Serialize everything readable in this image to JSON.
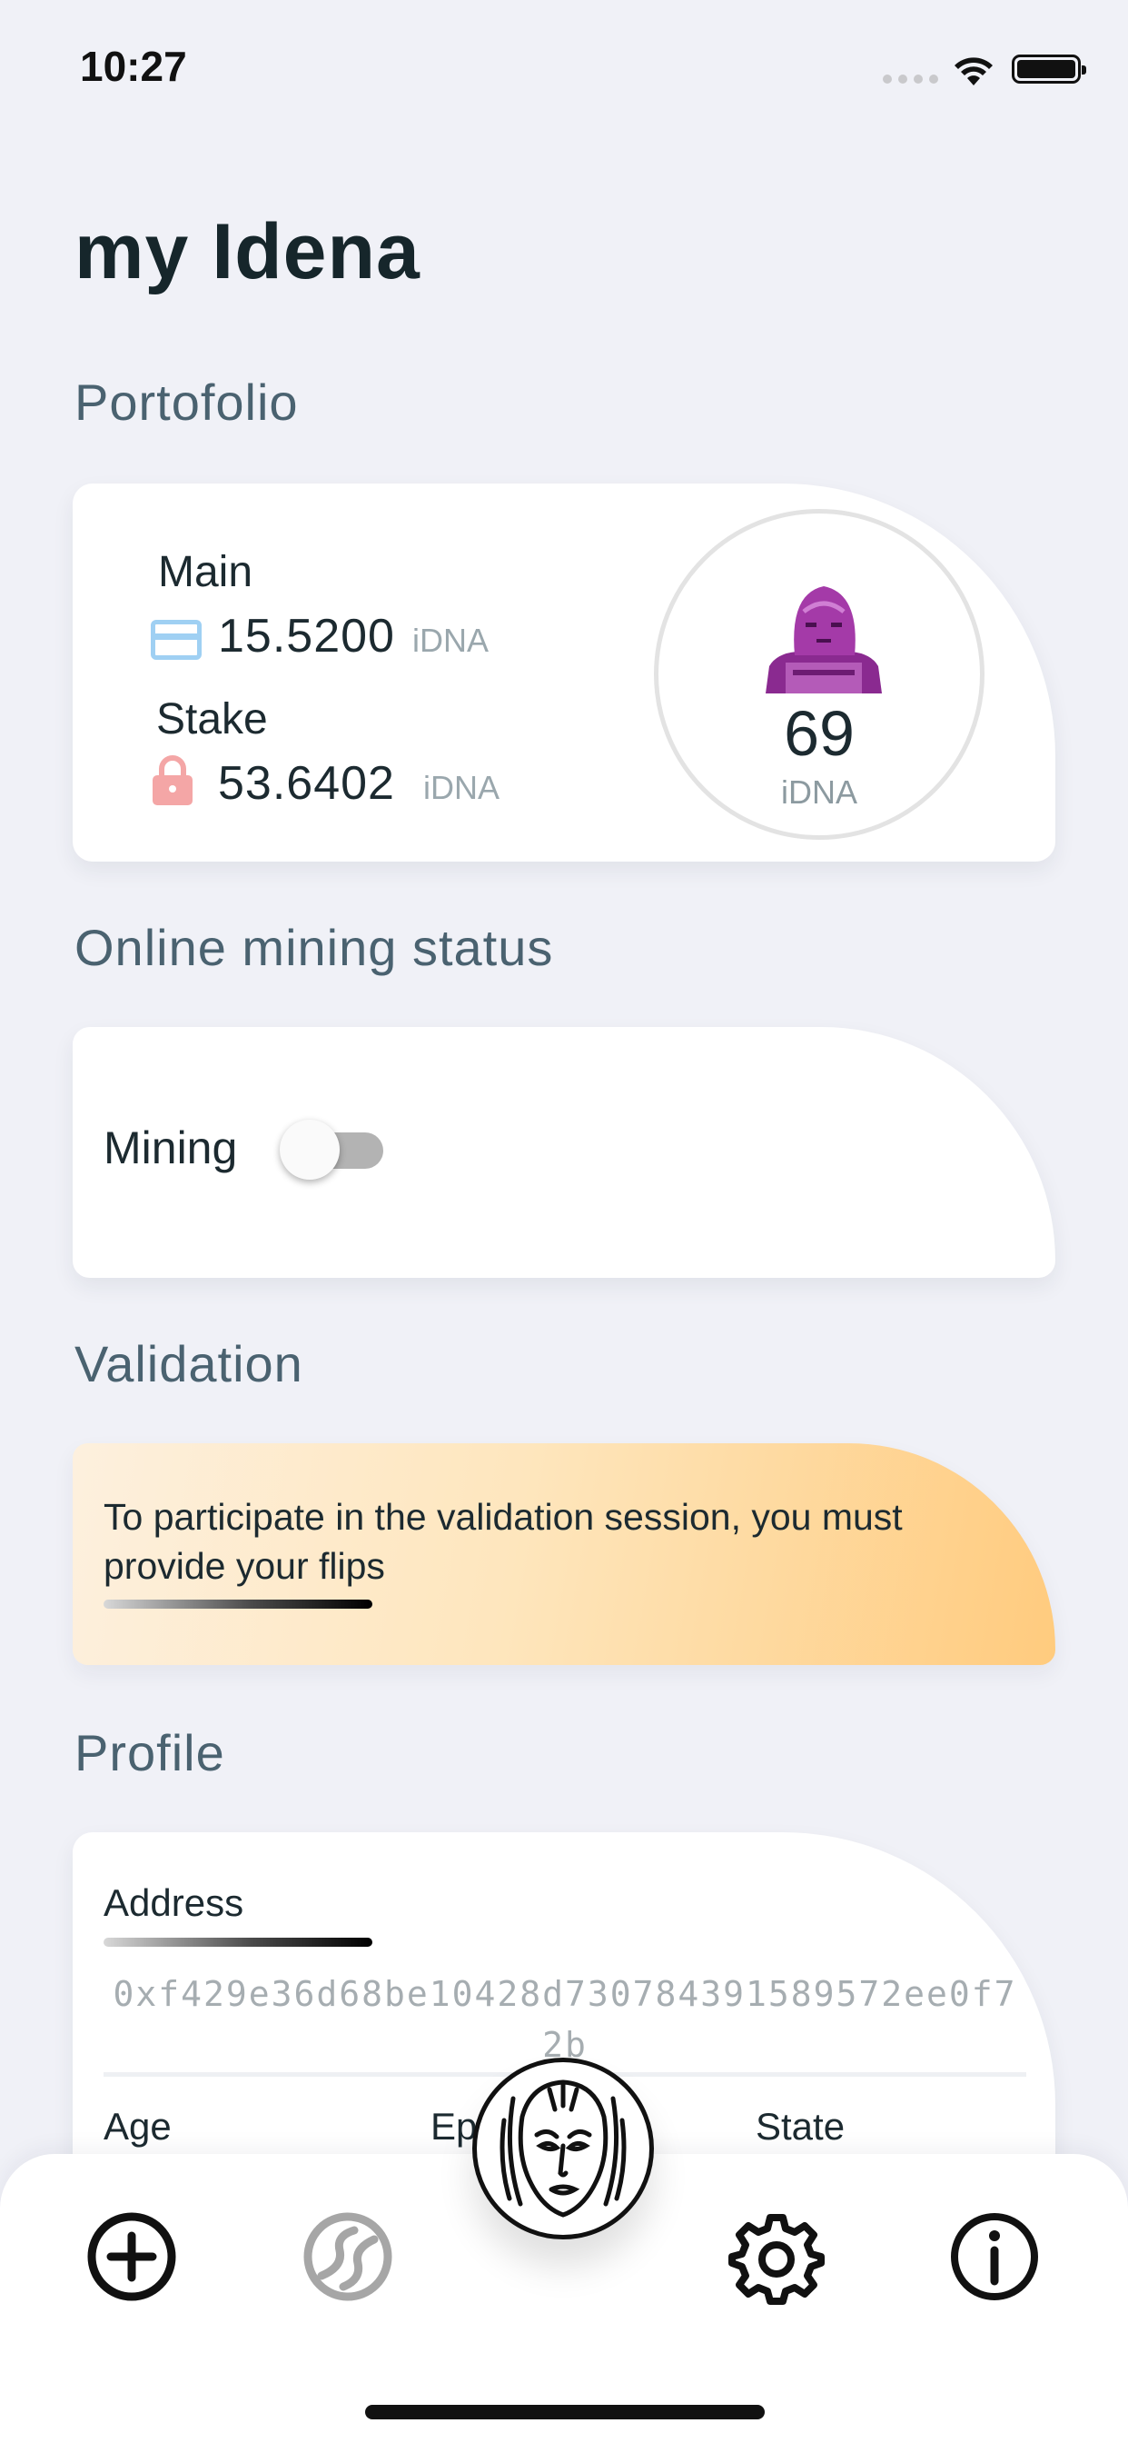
{
  "status_bar": {
    "time": "10:27"
  },
  "page_title": "my Idena",
  "portfolio": {
    "heading": "Portofolio",
    "main_label": "Main",
    "main_amount": "15.5200",
    "main_unit": "iDNA",
    "stake_label": "Stake",
    "stake_amount": "53.6402",
    "stake_unit": "iDNA",
    "total_amount": "69",
    "total_unit": "iDNA",
    "colors": {
      "card_icon": "#9fd0f3",
      "lock_icon": "#f4a6a6",
      "avatar": "#9a2f9e"
    }
  },
  "mining": {
    "heading": "Online mining status",
    "label": "Mining",
    "enabled": false
  },
  "validation": {
    "heading": "Validation",
    "message": "To participate in the validation session, you must provide your flips",
    "colors": {
      "gradient_start": "#fdf0de",
      "gradient_end": "#ffcb7e"
    }
  },
  "profile": {
    "heading": "Profile",
    "address_label": "Address",
    "address_value": "0xf429e36d68be10428d730784391589572ee0f72b",
    "age_label": "Age",
    "epoch_label": "Epoch",
    "state_label": "State"
  },
  "bottom_nav": {
    "items": [
      {
        "icon": "plus-circle-icon"
      },
      {
        "icon": "globe-icon"
      },
      {
        "icon": "idena-face-logo"
      },
      {
        "icon": "gear-icon"
      },
      {
        "icon": "info-icon"
      }
    ]
  }
}
